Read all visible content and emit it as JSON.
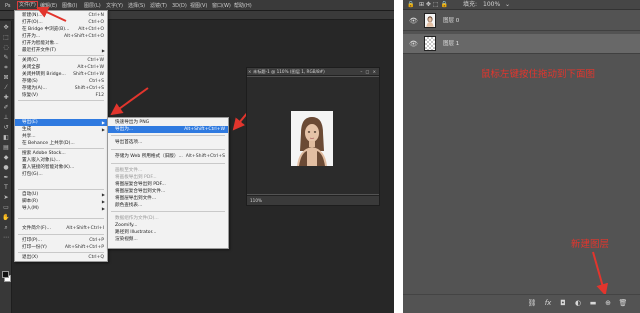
{
  "menubar": {
    "items": [
      "文件(F)",
      "编辑(E)",
      "图像(I)",
      "图层(L)",
      "文字(Y)",
      "选择(S)",
      "滤镜(T)",
      "3D(D)",
      "视图(V)",
      "窗口(W)",
      "帮助(H)"
    ]
  },
  "file_menu": {
    "items": [
      {
        "label": "新建(N)...",
        "shortcut": "Ctrl+N"
      },
      {
        "label": "打开(O)...",
        "shortcut": "Ctrl+O"
      },
      {
        "label": "在 Bridge 中浏览(B)...",
        "shortcut": "Alt+Ctrl+O"
      },
      {
        "label": "打开为...",
        "shortcut": "Alt+Shift+Ctrl+O"
      },
      {
        "label": "打开为智能对象...",
        "shortcut": ""
      },
      {
        "label": "最近打开文件(T)",
        "shortcut": ""
      },
      {
        "label": "关闭(C)",
        "shortcut": "Ctrl+W"
      },
      {
        "label": "关闭全部",
        "shortcut": "Alt+Ctrl+W"
      },
      {
        "label": "关闭并转到 Bridge...",
        "shortcut": "Shift+Ctrl+W"
      },
      {
        "label": "存储(S)",
        "shortcut": "Ctrl+S"
      },
      {
        "label": "存储为(A)...",
        "shortcut": "Shift+Ctrl+S"
      },
      {
        "label": "恢复(V)",
        "shortcut": "F12"
      },
      {
        "label": "导出(E)",
        "shortcut": ""
      },
      {
        "label": "生成",
        "shortcut": ""
      },
      {
        "label": "共享...",
        "shortcut": ""
      },
      {
        "label": "在 Behance 上共享(D)...",
        "shortcut": ""
      },
      {
        "label": "搜索 Adobe Stock...",
        "shortcut": ""
      },
      {
        "label": "置入嵌入对象(L)...",
        "shortcut": ""
      },
      {
        "label": "置入链接的智能对象(K)...",
        "shortcut": ""
      },
      {
        "label": "打包(G)...",
        "shortcut": ""
      },
      {
        "label": "自动(U)",
        "shortcut": ""
      },
      {
        "label": "脚本(R)",
        "shortcut": ""
      },
      {
        "label": "导入(M)",
        "shortcut": ""
      },
      {
        "label": "文件简介(F)...",
        "shortcut": "Alt+Shift+Ctrl+I"
      },
      {
        "label": "打印(P)...",
        "shortcut": "Ctrl+P"
      },
      {
        "label": "打印一份(Y)",
        "shortcut": "Alt+Shift+Ctrl+P"
      },
      {
        "label": "退出(X)",
        "shortcut": "Ctrl+Q"
      }
    ]
  },
  "export_menu": {
    "items": [
      {
        "label": "快速导出为 PNG",
        "shortcut": ""
      },
      {
        "label": "导出为...",
        "shortcut": "Alt+Shift+Ctrl+W"
      },
      {
        "label": "导出首选项...",
        "shortcut": ""
      },
      {
        "label": "存储为 Web 所用格式（旧版）...",
        "shortcut": "Alt+Shift+Ctrl+S"
      },
      {
        "label": "画板至文件...",
        "shortcut": ""
      },
      {
        "label": "将画板导出到 PDF...",
        "shortcut": ""
      },
      {
        "label": "将图层复合导出到 PDF...",
        "shortcut": ""
      },
      {
        "label": "将图层复合导出到文件...",
        "shortcut": ""
      },
      {
        "label": "将图层导出到文件...",
        "shortcut": ""
      },
      {
        "label": "颜色查找表...",
        "shortcut": ""
      },
      {
        "label": "数据组作为文件(D)...",
        "shortcut": ""
      },
      {
        "label": "Zoomify...",
        "shortcut": ""
      },
      {
        "label": "路径到 Illustrator...",
        "shortcut": ""
      },
      {
        "label": "渲染视频...",
        "shortcut": ""
      }
    ]
  },
  "document": {
    "title": "未标题-1 @ 110% (图层 1, RGB/8#)",
    "zoom": "110%"
  },
  "layers_panel": {
    "opacity_label": "不透明度:",
    "opacity_value": "100%",
    "fill_label": "填充:",
    "fill_value": "100%",
    "layers": [
      {
        "name": "图层 0"
      },
      {
        "name": "图层 1"
      }
    ],
    "annotation_drag": "鼠标左键按住拖动到下面图",
    "annotation_new_layer": "新建图层",
    "bottom_buttons": [
      "link-icon",
      "fx-icon",
      "mask-icon",
      "adjustment-icon",
      "folder-icon",
      "new-layer-icon",
      "trash-icon"
    ]
  },
  "colors": {
    "annotation_red": "#e2352d",
    "menu_highlight": "#2f7ae0"
  }
}
